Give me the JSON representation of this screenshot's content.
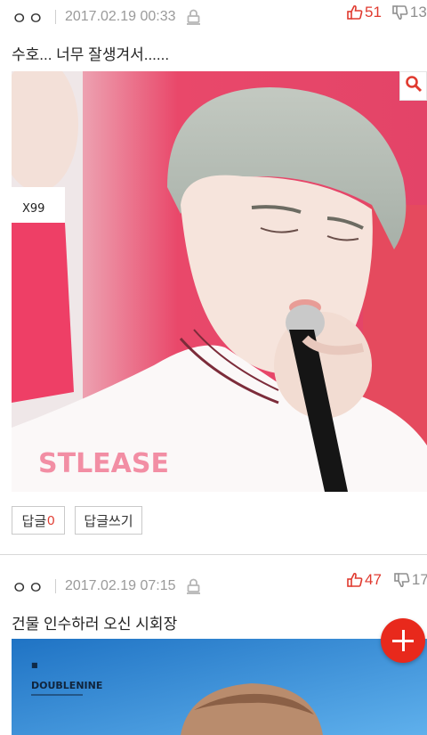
{
  "posts": [
    {
      "author": "ㅇㅇ",
      "date": "2017.02.19 00:33",
      "likes": "51",
      "dislikes": "13",
      "title": "수호... 너무 잘생겨서......",
      "reply_label": "답글",
      "reply_count": "0",
      "write_reply_label": "답글쓰기"
    },
    {
      "author": "ㅇㅇ",
      "date": "2017.02.19 07:15",
      "likes": "47",
      "dislikes": "17",
      "title": "건물 인수하러 오신 시회장",
      "image_text": {
        "brand": "DOUBLENINE"
      }
    }
  ],
  "icons": {
    "lock": "lock-icon",
    "thumbs_up": "thumbs-up-icon",
    "thumbs_down": "thumbs-down-icon",
    "search": "search-icon",
    "add": "plus-icon"
  },
  "colors": {
    "accent": "#e03a2f",
    "fab": "#e8291c",
    "muted": "#9a9a9a"
  }
}
